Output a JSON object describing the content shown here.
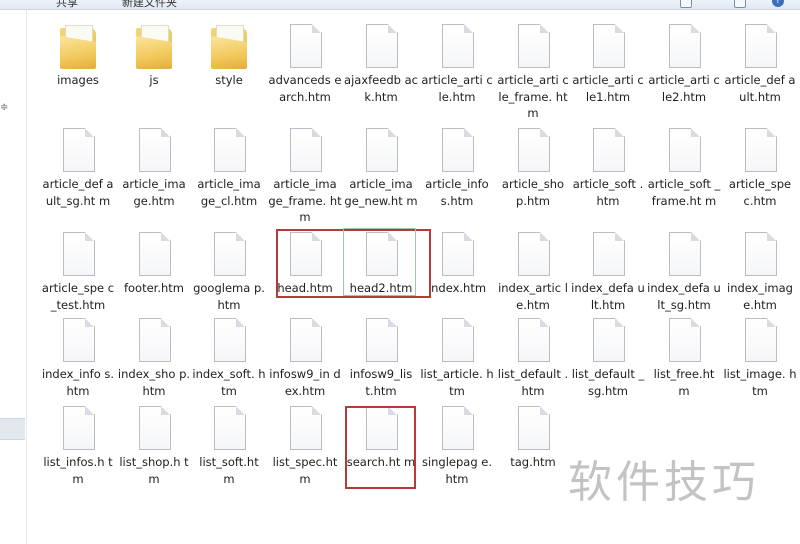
{
  "toolbar": {
    "menu_share": "共享",
    "menu_new_folder": "新建文件夹"
  },
  "items": [
    {
      "name": "images",
      "type": "folder"
    },
    {
      "name": "js",
      "type": "folder"
    },
    {
      "name": "style",
      "type": "folder"
    },
    {
      "name": "advanceds earch.htm",
      "type": "file"
    },
    {
      "name": "ajaxfeedb ack.htm",
      "type": "file"
    },
    {
      "name": "article_arti cle.htm",
      "type": "file"
    },
    {
      "name": "article_arti cle_frame. htm",
      "type": "file"
    },
    {
      "name": "article_arti cle1.htm",
      "type": "file"
    },
    {
      "name": "article_arti cle2.htm",
      "type": "file"
    },
    {
      "name": "article_def ault.htm",
      "type": "file"
    },
    {
      "name": "article_def ault_sg.ht m",
      "type": "file"
    },
    {
      "name": "article_ima ge.htm",
      "type": "file"
    },
    {
      "name": "article_ima ge_cl.htm",
      "type": "file"
    },
    {
      "name": "article_ima ge_frame. htm",
      "type": "file"
    },
    {
      "name": "article_ima ge_new.ht m",
      "type": "file"
    },
    {
      "name": "article_info s.htm",
      "type": "file"
    },
    {
      "name": "article_sho p.htm",
      "type": "file"
    },
    {
      "name": "article_soft .htm",
      "type": "file"
    },
    {
      "name": "article_soft _frame.ht m",
      "type": "file"
    },
    {
      "name": "article_spe c.htm",
      "type": "file"
    },
    {
      "name": "article_spe c_test.htm",
      "type": "file"
    },
    {
      "name": "footer.htm",
      "type": "file"
    },
    {
      "name": "googlema p.htm",
      "type": "file"
    },
    {
      "name": "head.htm",
      "type": "file"
    },
    {
      "name": "head2.htm",
      "type": "file"
    },
    {
      "name": "index.htm",
      "type": "file"
    },
    {
      "name": "index_artic le.htm",
      "type": "file"
    },
    {
      "name": "index_defa ult.htm",
      "type": "file"
    },
    {
      "name": "index_defa ult_sg.htm",
      "type": "file"
    },
    {
      "name": "index_imag e.htm",
      "type": "file"
    },
    {
      "name": "index_info s.htm",
      "type": "file"
    },
    {
      "name": "index_sho p.htm",
      "type": "file"
    },
    {
      "name": "index_soft. htm",
      "type": "file"
    },
    {
      "name": "infosw9_in dex.htm",
      "type": "file"
    },
    {
      "name": "infosw9_lis t.htm",
      "type": "file"
    },
    {
      "name": "list_article. htm",
      "type": "file"
    },
    {
      "name": "list_default .htm",
      "type": "file"
    },
    {
      "name": "list_default _sg.htm",
      "type": "file"
    },
    {
      "name": "list_free.ht m",
      "type": "file"
    },
    {
      "name": "list_image. htm",
      "type": "file"
    },
    {
      "name": "list_infos.h tm",
      "type": "file"
    },
    {
      "name": "list_shop.h tm",
      "type": "file"
    },
    {
      "name": "list_soft.ht m",
      "type": "file"
    },
    {
      "name": "list_spec.ht m",
      "type": "file"
    },
    {
      "name": "search.ht m",
      "type": "file"
    },
    {
      "name": "singlepag e.htm",
      "type": "file"
    },
    {
      "name": "tag.htm",
      "type": "file"
    }
  ],
  "watermark": "软件技巧",
  "colors": {
    "highlight": "#b53a3a",
    "folder": "#f2c85b",
    "watermark": "#b9b9b9"
  }
}
